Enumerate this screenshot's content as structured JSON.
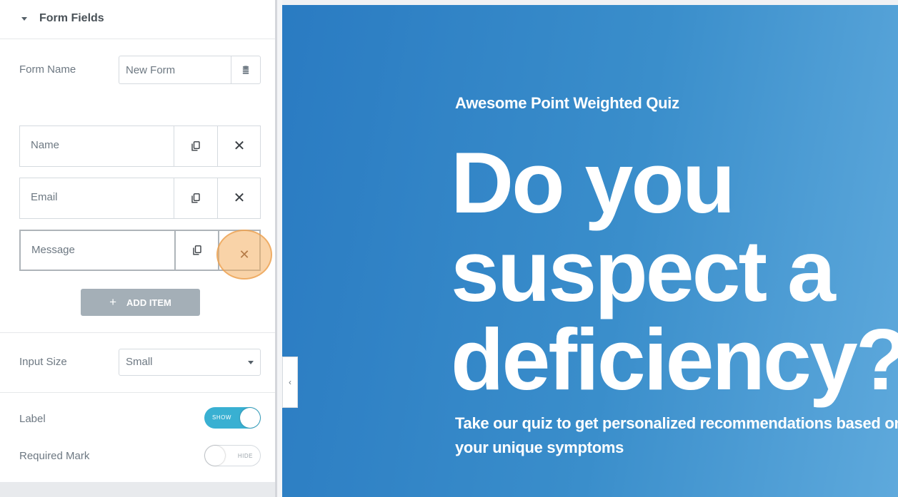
{
  "panel": {
    "section_title": "Form Fields",
    "form_name": {
      "label": "Form Name",
      "value": "New Form"
    },
    "fields": [
      {
        "label": "Name"
      },
      {
        "label": "Email"
      },
      {
        "label": "Message"
      }
    ],
    "add_item_label": "ADD ITEM",
    "input_size": {
      "label": "Input Size",
      "value": "Small"
    },
    "label_switch": {
      "label": "Label",
      "state_text": "SHOW",
      "on": true
    },
    "required_switch": {
      "label": "Required Mark",
      "state_text": "HIDE",
      "on": false
    }
  },
  "icons": {
    "section_caret": "caret-down-icon",
    "form_name_addon": "database-icon",
    "duplicate": "copy-icon",
    "remove": "close-icon",
    "add": "plus-icon",
    "select_arrow": "caret-down-icon",
    "collapse": "chevron-left-icon"
  },
  "preview": {
    "eyebrow": "Awesome Point Weighted Quiz",
    "headline": "Do you\nsuspect a\ndeficiency?",
    "subtext": "Take our quiz to get personalized recommendations based on your unique symptoms"
  },
  "colors": {
    "preview_bg": "#2a7bc2",
    "switch_on": "#39b0d2",
    "add_button": "#a4afb7",
    "highlight": "#f4af61"
  }
}
